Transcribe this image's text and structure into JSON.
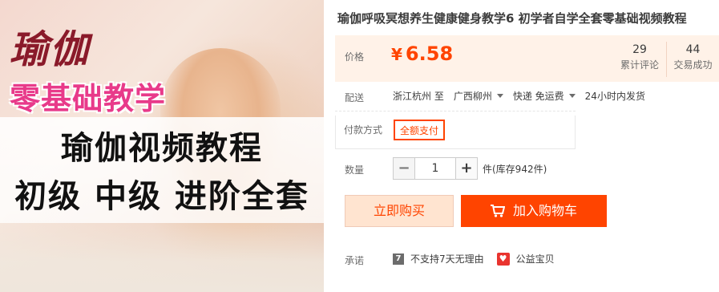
{
  "image": {
    "title": "瑜伽",
    "subtitle": "零基础教学",
    "line1": "瑜伽视频教程",
    "line2": "初级 中级 进阶全套"
  },
  "product": {
    "title": "瑜伽呼吸冥想养生健康健身教学6 初学者自学全套零基础视频教程"
  },
  "price": {
    "label": "价格",
    "currency": "¥",
    "value": "6.58",
    "color": "#ff4400",
    "stats": [
      {
        "num": "29",
        "label": "累计评论"
      },
      {
        "num": "44",
        "label": "交易成功"
      }
    ]
  },
  "shipping": {
    "label": "配送",
    "from": "浙江杭州 至",
    "to": "广西柳州",
    "method": "快递 免运费",
    "dispatch": "24小时内发货"
  },
  "payment": {
    "label": "付款方式",
    "option": "全额支付"
  },
  "quantity": {
    "label": "数量",
    "minus": "−",
    "value": "1",
    "plus": "+",
    "unit": "件(库存942件)"
  },
  "actions": {
    "buy_now": "立即购买",
    "add_cart": "加入购物车"
  },
  "promise": {
    "label": "承诺",
    "badge": "7",
    "no_return": "不支持7天无理由",
    "charity": "公益宝贝"
  }
}
